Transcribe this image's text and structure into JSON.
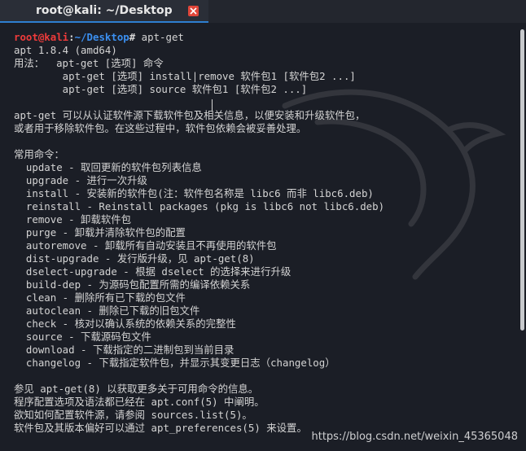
{
  "tab": {
    "title": "root@kali: ~/Desktop"
  },
  "prompt": {
    "user": "root@kali",
    "sep": ":",
    "path": "~/Desktop",
    "symbol": "#",
    "command": " apt-get"
  },
  "output": [
    "apt 1.8.4 (amd64)",
    "用法：  apt-get [选项] 命令",
    "        apt-get [选项] install|remove 软件包1 [软件包2 ...]",
    "        apt-get [选项] source 软件包1 [软件包2 ...]",
    "",
    "apt-get 可以从认证软件源下载软件包及相关信息，以便安装和升级软件包，",
    "或者用于移除软件包。在这些过程中，软件包依赖会被妥善处理。",
    "",
    "常用命令：",
    "  update - 取回更新的软件包列表信息",
    "  upgrade - 进行一次升级",
    "  install - 安装新的软件包(注：软件包名称是 libc6 而非 libc6.deb)",
    "  reinstall - Reinstall packages (pkg is libc6 not libc6.deb)",
    "  remove - 卸载软件包",
    "  purge - 卸载并清除软件包的配置",
    "  autoremove - 卸载所有自动安装且不再使用的软件包",
    "  dist-upgrade - 发行版升级，见 apt-get(8)",
    "  dselect-upgrade - 根据 dselect 的选择来进行升级",
    "  build-dep - 为源码包配置所需的编译依赖关系",
    "  clean - 删除所有已下载的包文件",
    "  autoclean - 删除已下载的旧包文件",
    "  check - 核对以确认系统的依赖关系的完整性",
    "  source - 下载源码包文件",
    "  download - 下载指定的二进制包到当前目录",
    "  changelog - 下载指定软件包，并显示其变更日志（changelog）",
    "",
    "参见 apt-get(8) 以获取更多关于可用命令的信息。",
    "程序配置选项及语法都已经在 apt.conf(5) 中阐明。",
    "欲知如何配置软件源，请参阅 sources.list(5)。",
    "软件包及其版本偏好可以通过 apt_preferences(5) 来设置。"
  ],
  "watermark": "https://blog.csdn.net/weixin_45365048",
  "icons": {
    "close": "close-icon",
    "background": "kali-dragon-watermark"
  },
  "colors": {
    "background": "#1b1e26",
    "prompt_user": "#ef3b3b",
    "prompt_path": "#3b8ff0",
    "tab_accent": "#2e7fd1",
    "close": "#e0463a"
  }
}
